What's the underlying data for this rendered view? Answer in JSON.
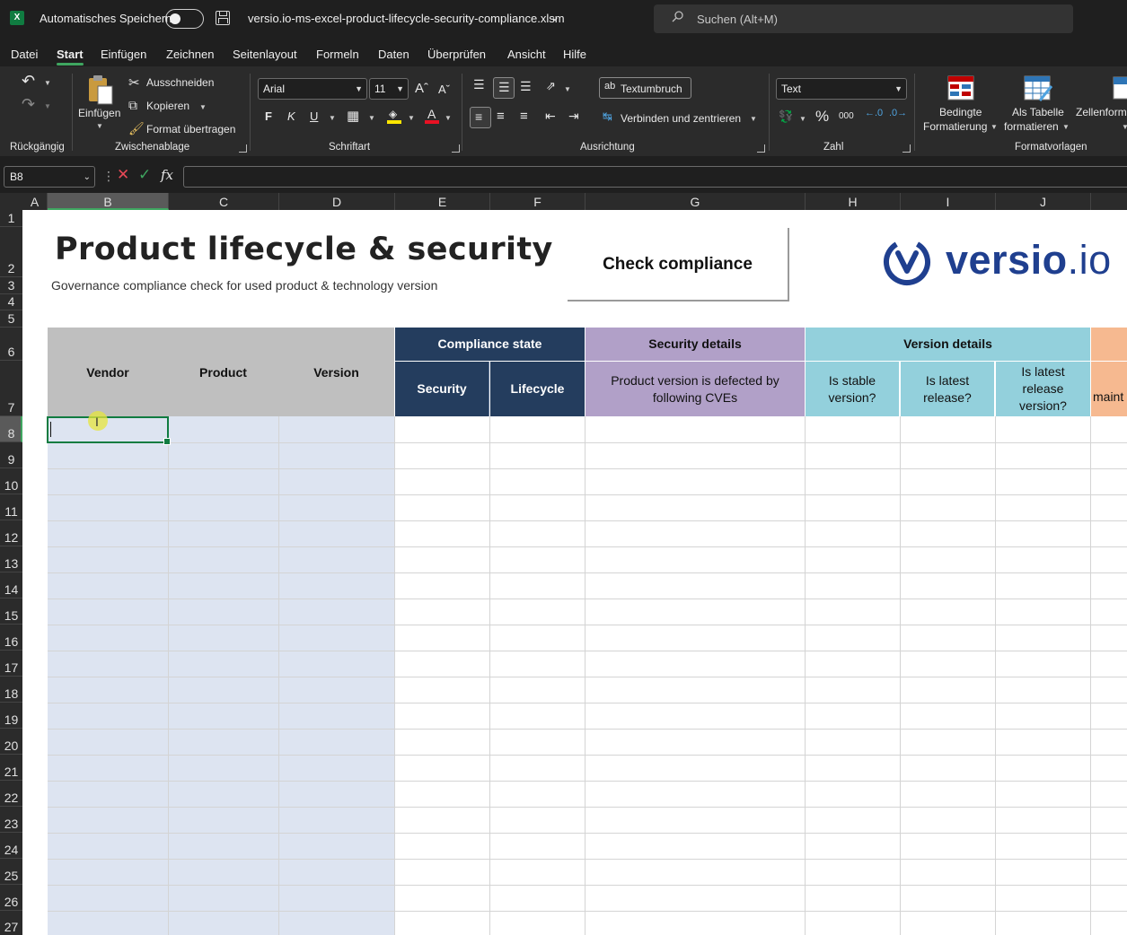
{
  "app": {
    "autosave_label": "Automatisches Speichern",
    "filename": "versio.io-ms-excel-product-lifecycle-security-compliance.xlsm",
    "search_placeholder": "Suchen (Alt+M)"
  },
  "menu": [
    "Datei",
    "Start",
    "Einfügen",
    "Zeichnen",
    "Seitenlayout",
    "Formeln",
    "Daten",
    "Überprüfen",
    "Ansicht",
    "Hilfe"
  ],
  "menu_active": "Start",
  "ribbon": {
    "groups": {
      "undo": "Rückgängig",
      "clipboard": "Zwischenablage",
      "font": "Schriftart",
      "alignment": "Ausrichtung",
      "number": "Zahl",
      "styles": "Formatvorlagen"
    },
    "clipboard": {
      "paste": "Einfügen",
      "cut": "Ausschneiden",
      "copy": "Kopieren",
      "format_painter": "Format übertragen"
    },
    "font": {
      "name": "Arial",
      "size": "11",
      "bold": "F",
      "italic": "K",
      "underline": "U"
    },
    "alignment": {
      "wrap_text": "Textumbruch",
      "merge_center": "Verbinden und zentrieren"
    },
    "number": {
      "format": "Text",
      "percent": "%",
      "thousands": "000"
    },
    "styles": {
      "conditional_1": "Bedingte",
      "conditional_2": "Formatierung",
      "as_table_1": "Als Tabelle",
      "as_table_2": "formatieren",
      "cell_styles": "Zellenform"
    }
  },
  "formula_bar": {
    "name_box": "B8",
    "fx": "fx",
    "value": ""
  },
  "columns": [
    "A",
    "B",
    "C",
    "D",
    "E",
    "F",
    "G",
    "H",
    "I",
    "J"
  ],
  "selected_column": "B",
  "rows": [
    "1",
    "2",
    "3",
    "4",
    "5",
    "6",
    "7",
    "8",
    "9",
    "10",
    "11",
    "12",
    "13",
    "14",
    "15",
    "16",
    "17",
    "18",
    "19",
    "20",
    "21",
    "22",
    "23",
    "24",
    "25",
    "26",
    "27"
  ],
  "selected_row": "8",
  "sheet": {
    "title": "Product lifecycle & security",
    "subtitle": "Governance compliance check for used product & technology version",
    "check_button": "Check compliance",
    "logo_brand": "versio",
    "logo_suffix": ".io",
    "headers": {
      "vendor": "Vendor",
      "product": "Product",
      "version": "Version",
      "compliance_state": "Compliance state",
      "security": "Security",
      "lifecycle": "Lifecycle",
      "security_details": "Security details",
      "cves": "Product version is defected by following CVEs",
      "version_details": "Version details",
      "stable": "Is stable version?",
      "latest": "Is latest release?",
      "latest_release_version": "Is latest release version?",
      "maint_partial": "maint"
    }
  },
  "colors": {
    "excel_green": "#107c41",
    "navy_header": "#243d5e",
    "purple_header": "#b1a0c8",
    "cyan_header": "#93d0dc",
    "gray_header": "#bfbfbf",
    "input_fill": "#dde4f1",
    "logo_blue": "#1f3f8f"
  }
}
